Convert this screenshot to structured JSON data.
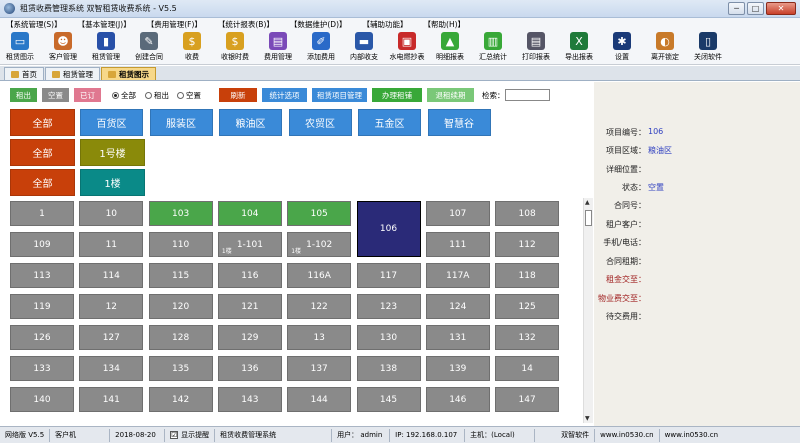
{
  "window": {
    "title": "租赁收费管理系统  双智租赁收费系统 - V5.5",
    "min": "─",
    "max": "□",
    "close": "✕"
  },
  "menu": [
    "【系统管理(S)】",
    "【基本管理(J)】",
    "【费用管理(F)】",
    "【统计报表(B)】",
    "【数据维护(D)】",
    "【辅助功能】",
    "【帮助(H)】"
  ],
  "toolbar": [
    {
      "label": "租赁图示",
      "icon": "monitor-icon",
      "color": "#2a78c8",
      "glyph": "▭"
    },
    {
      "label": "客户管理",
      "icon": "users-icon",
      "color": "#c86a2a",
      "glyph": "☻"
    },
    {
      "label": "租赁管理",
      "icon": "book-icon",
      "color": "#2850a8",
      "glyph": "▮"
    },
    {
      "label": "创建合同",
      "icon": "contract-icon",
      "color": "#5a6a7a",
      "glyph": "✎"
    },
    {
      "label": "收费",
      "icon": "coin-icon",
      "color": "#d8a020",
      "glyph": "$"
    },
    {
      "label": "收银时费",
      "icon": "coin-icon",
      "color": "#d8a020",
      "glyph": "$"
    },
    {
      "label": "费用管理",
      "icon": "printer-icon",
      "color": "#7a4ab8",
      "glyph": "▤"
    },
    {
      "label": "添加费用",
      "icon": "pen-icon",
      "color": "#2a6ac8",
      "glyph": "✐"
    },
    {
      "label": "内部收支",
      "icon": "card-icon",
      "color": "#2a58a8",
      "glyph": "▬"
    },
    {
      "label": "水电燃抄表",
      "icon": "clipboard-icon",
      "color": "#c82a2a",
      "glyph": "▣"
    },
    {
      "label": "明细报表",
      "icon": "pyramid-icon",
      "color": "#38a838",
      "glyph": "▲"
    },
    {
      "label": "汇总统计",
      "icon": "bar-chart-icon",
      "color": "#38a838",
      "glyph": "▥"
    },
    {
      "label": "打印报表",
      "icon": "print-icon",
      "color": "#555566",
      "glyph": "▤"
    },
    {
      "label": "导出报表",
      "icon": "excel-icon",
      "color": "#1f7a3a",
      "glyph": "X"
    },
    {
      "label": "设置",
      "icon": "gear-icon",
      "color": "#1a3a78",
      "glyph": "✱"
    },
    {
      "label": "离开锁定",
      "icon": "lock-icon",
      "color": "#c87a2a",
      "glyph": "◐"
    },
    {
      "label": "关闭软件",
      "icon": "exit-icon",
      "color": "#1a3a68",
      "glyph": "▯"
    }
  ],
  "tabs": [
    "首页",
    "租赁管理",
    "租赁图示"
  ],
  "controls": {
    "rent_out": "租出",
    "vacant": "空置",
    "dropdown": "已订",
    "all": "全部",
    "rented": "租出",
    "empty": "空置",
    "refresh": "刷新",
    "stat": "统计选项",
    "project": "租赁项目管理",
    "handle": "办理租铺",
    "renew": "退租续期",
    "search": "检索："
  },
  "areas": [
    "全部",
    "百货区",
    "服装区",
    "粮油区",
    "农贸区",
    "五金区",
    "智慧谷"
  ],
  "buildings": [
    "全部",
    "1号楼"
  ],
  "floors": [
    "全部",
    "1楼"
  ],
  "cells": [
    [
      "1",
      "10",
      "103",
      "104",
      "105",
      "106",
      "107",
      "108"
    ],
    [
      "109",
      "11",
      "110",
      "1-101",
      "1-102",
      "",
      "111",
      "112"
    ],
    [
      "113",
      "114",
      "115",
      "116",
      "116A",
      "117",
      "117A",
      "118"
    ],
    [
      "119",
      "12",
      "120",
      "121",
      "122",
      "123",
      "124",
      "125"
    ],
    [
      "126",
      "127",
      "128",
      "129",
      "13",
      "130",
      "131",
      "132"
    ],
    [
      "133",
      "134",
      "135",
      "136",
      "137",
      "138",
      "139",
      "14"
    ],
    [
      "140",
      "141",
      "142",
      "143",
      "144",
      "145",
      "146",
      "147"
    ]
  ],
  "cell_sub": {
    "1-101": "1楼",
    "1-102": "1楼"
  },
  "details": {
    "labels": [
      "项目编号：",
      "项目区域：",
      "详细位置：",
      "状态：",
      "合同号：",
      "租户客户：",
      "手机/电话：",
      "合同租期：",
      "租金交至：",
      "物业费交至：",
      "待交费用："
    ],
    "values": [
      "106",
      "粮油区",
      "",
      "空置",
      "",
      "",
      "",
      "",
      "",
      "",
      ""
    ]
  },
  "status": {
    "version": "网络版 V5.5",
    "client": "客户机",
    "date": "2018-08-20",
    "reminder": "显示提醒",
    "checkmark": "☑",
    "system": "租赁收费管理系统",
    "user": "用户： admin",
    "ip": "IP: 192.168.0.107",
    "host": "主机：(Local)",
    "vendor": "双智软件",
    "site1": "www.in0530.cn",
    "site2": "www.in0530.cn"
  },
  "colors": {
    "vacant": "#8a8a8a",
    "green": "#4aa64a",
    "selected": "#2a2a78",
    "area": "#3a8ad8",
    "all": "#c8400a",
    "building": "#8a8a0a",
    "floor": "#0a8a88"
  }
}
